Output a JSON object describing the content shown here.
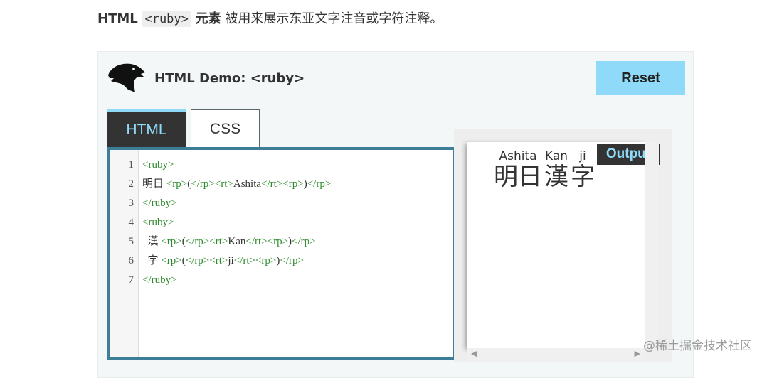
{
  "intro": {
    "prefix": "HTML",
    "code": "<ruby>",
    "bold_suffix": "元素",
    "text": "被用来展示东亚文字注音或字符注释。"
  },
  "demo": {
    "title": "HTML Demo: <ruby>",
    "reset_label": "Reset",
    "tabs": [
      {
        "label": "HTML",
        "active": true
      },
      {
        "label": "CSS",
        "active": false
      }
    ],
    "code_lines": [
      {
        "num": "1",
        "parts": [
          {
            "t": "tag",
            "v": "<ruby>"
          }
        ]
      },
      {
        "num": "2",
        "parts": [
          {
            "t": "txt",
            "v": "明日 "
          },
          {
            "t": "tag",
            "v": "<rp>"
          },
          {
            "t": "txt",
            "v": "("
          },
          {
            "t": "tag",
            "v": "</rp><rt>"
          },
          {
            "t": "txt",
            "v": "Ashita"
          },
          {
            "t": "tag",
            "v": "</rt><rp>"
          },
          {
            "t": "txt",
            "v": ")"
          },
          {
            "t": "tag",
            "v": "</rp>"
          }
        ]
      },
      {
        "num": "3",
        "parts": [
          {
            "t": "tag",
            "v": "</ruby>"
          }
        ]
      },
      {
        "num": "4",
        "parts": [
          {
            "t": "tag",
            "v": "<ruby>"
          }
        ]
      },
      {
        "num": "5",
        "parts": [
          {
            "t": "txt",
            "v": "  漢 "
          },
          {
            "t": "tag",
            "v": "<rp>"
          },
          {
            "t": "txt",
            "v": "("
          },
          {
            "t": "tag",
            "v": "</rp><rt>"
          },
          {
            "t": "txt",
            "v": "Kan"
          },
          {
            "t": "tag",
            "v": "</rt><rp>"
          },
          {
            "t": "txt",
            "v": ")"
          },
          {
            "t": "tag",
            "v": "</rp>"
          }
        ]
      },
      {
        "num": "6",
        "parts": [
          {
            "t": "txt",
            "v": "  字 "
          },
          {
            "t": "tag",
            "v": "<rp>"
          },
          {
            "t": "txt",
            "v": "("
          },
          {
            "t": "tag",
            "v": "</rp><rt>"
          },
          {
            "t": "txt",
            "v": "ji"
          },
          {
            "t": "tag",
            "v": "</rt><rp>"
          },
          {
            "t": "txt",
            "v": ")"
          },
          {
            "t": "tag",
            "v": "</rp>"
          }
        ]
      },
      {
        "num": "7",
        "parts": [
          {
            "t": "tag",
            "v": "</ruby>"
          }
        ]
      }
    ],
    "output_label": "Output",
    "output": [
      {
        "base": "明日",
        "annotation": "Ashita"
      },
      {
        "base": "漢",
        "annotation": "Kan"
      },
      {
        "base": "字",
        "annotation": "ji"
      }
    ]
  },
  "watermark": "@稀土掘金技术社区",
  "colors": {
    "accent": "#8fdaf8",
    "editor_border": "#3d7d97",
    "tag_green": "#2e8b2e",
    "dark": "#333333"
  },
  "icons": {
    "logo": "dinosaur-head-icon",
    "scroll_left": "arrow-left-icon",
    "scroll_right": "arrow-right-icon"
  }
}
